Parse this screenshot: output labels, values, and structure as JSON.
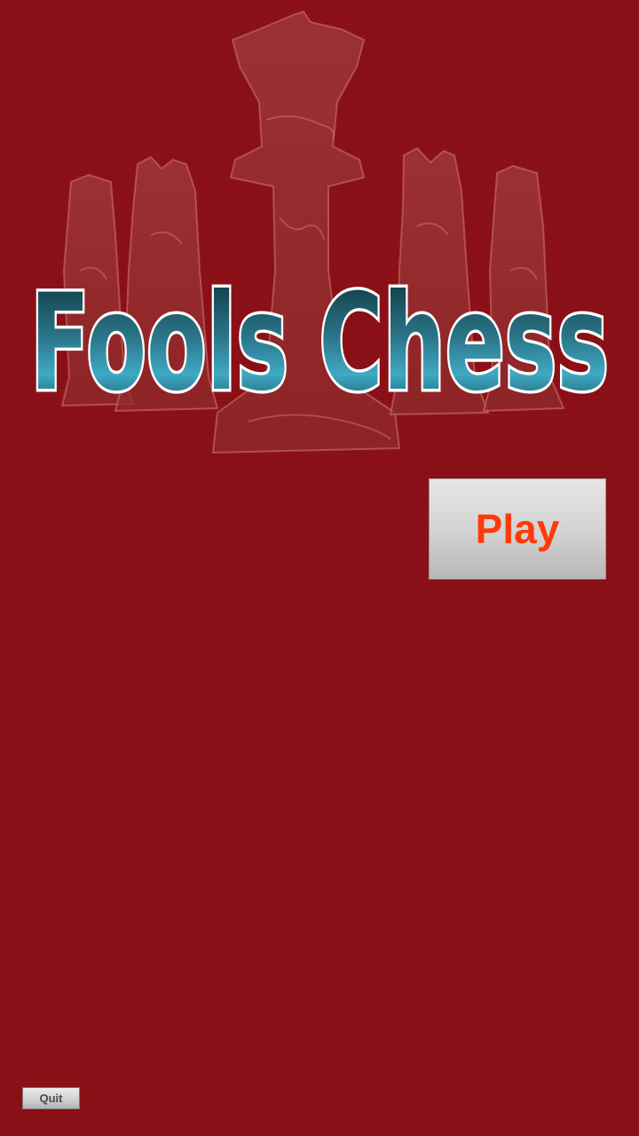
{
  "app": {
    "title": "Fools Chess"
  },
  "menu": {
    "play_label": "Play",
    "quit_label": "Quit"
  },
  "icons": {
    "background_art": "chess-pieces-icon"
  },
  "colors": {
    "background": "#8b0f17",
    "play_text": "#ff3a0a",
    "title_fill": "#1e5b6e",
    "title_outline": "#ffffff"
  }
}
